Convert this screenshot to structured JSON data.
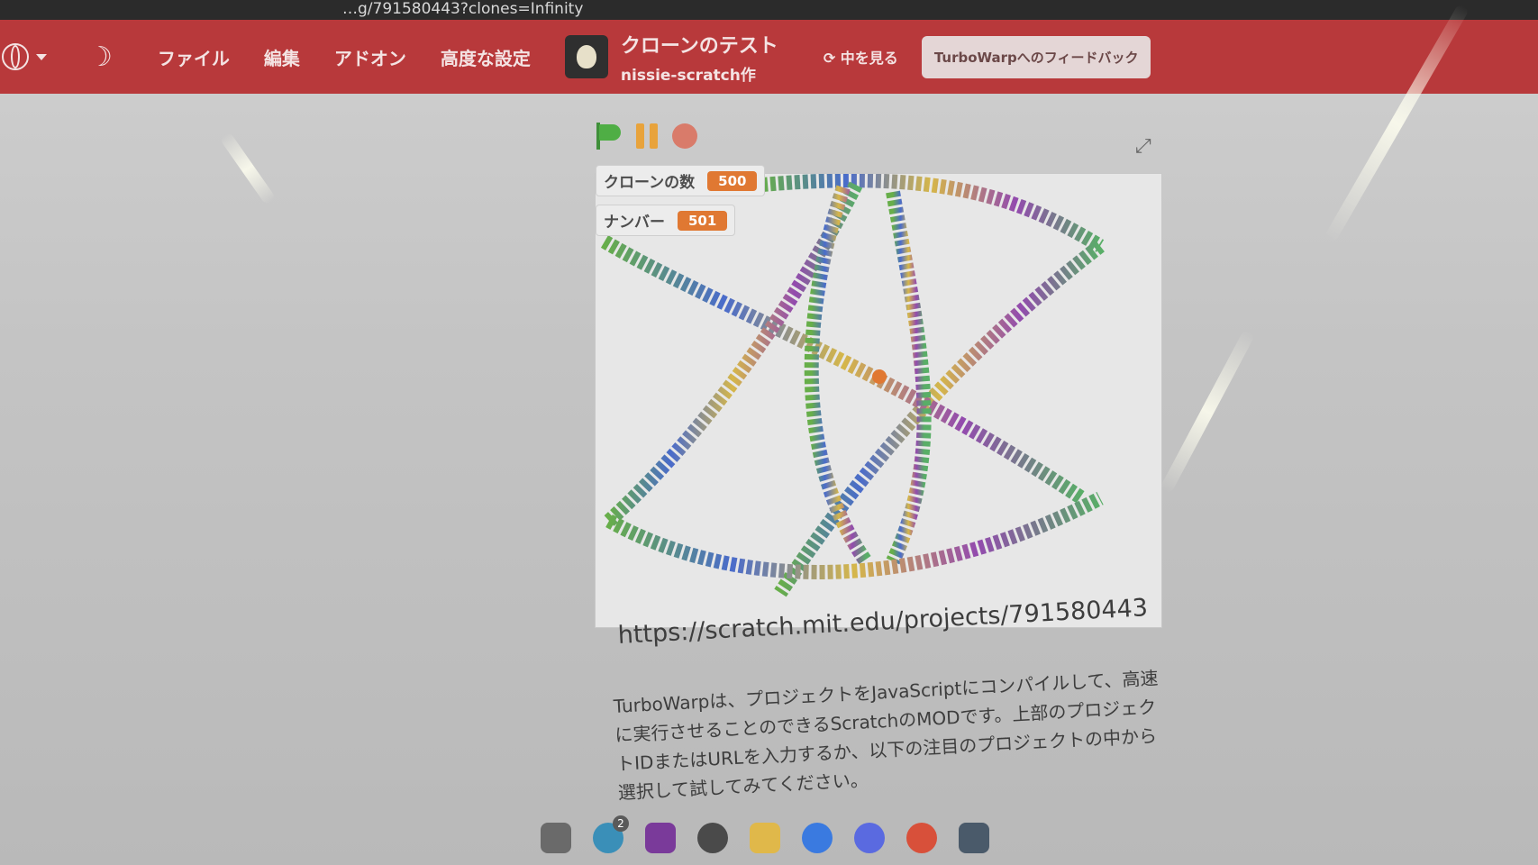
{
  "browser": {
    "url_fragment": "…g/791580443?clones=Infinity"
  },
  "menubar": {
    "items": [
      "ファイル",
      "編集",
      "アドオン",
      "高度な設定"
    ],
    "project_title": "クローンのテスト",
    "project_author": "nissie-scratch作",
    "see_inside": "中を見る",
    "feedback": "TurboWarpへのフィードバック"
  },
  "colors": {
    "menubar": "#b8393b",
    "monitor_value": "#e07832",
    "flag": "#4fae45",
    "pause": "#e8a33c"
  },
  "stage": {
    "monitors": [
      {
        "label": "クローンの数",
        "value": "500"
      },
      {
        "label": "ナンバー",
        "value": "501"
      }
    ]
  },
  "page": {
    "project_url": "https://scratch.mit.edu/projects/791580443",
    "description_lines": [
      "TurboWarpは、プロジェクトをJavaScriptにコンパイルして、高速",
      "に実行させることのできるScratchのMODです。上部のプロジェク",
      "トIDまたはURLを入力するか、以下の注目のプロジェクトの中から",
      "選択して試してみてください。"
    ]
  },
  "taskbar": {
    "badge": "2",
    "icons": [
      "files-icon",
      "edge-icon",
      "onenote-icon",
      "github-icon",
      "folder-icon",
      "zoom-icon",
      "discord-icon",
      "chrome-icon",
      "app-icon"
    ]
  }
}
